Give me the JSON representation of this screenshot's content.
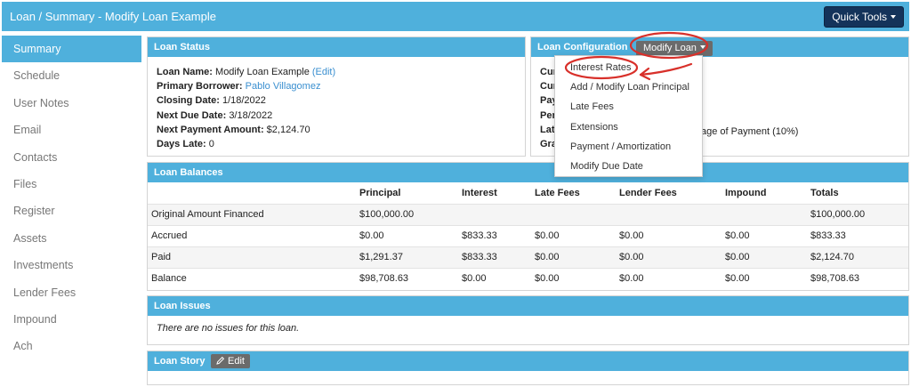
{
  "header": {
    "title": "Loan / Summary - Modify Loan Example",
    "quick_tools_label": "Quick Tools"
  },
  "sidebar": {
    "items": [
      {
        "label": "Summary",
        "active": true
      },
      {
        "label": "Schedule"
      },
      {
        "label": "User Notes"
      },
      {
        "label": "Email"
      },
      {
        "label": "Contacts"
      },
      {
        "label": "Files"
      },
      {
        "label": "Register"
      },
      {
        "label": "Assets"
      },
      {
        "label": "Investments"
      },
      {
        "label": "Lender Fees"
      },
      {
        "label": "Impound"
      },
      {
        "label": "Ach"
      }
    ]
  },
  "loan_status": {
    "title": "Loan Status",
    "loan_name_label": "Loan Name:",
    "loan_name": "Modify Loan Example",
    "edit_link": "(Edit)",
    "primary_borrower_label": "Primary Borrower:",
    "primary_borrower": "Pablo Villagomez",
    "closing_date_label": "Closing Date:",
    "closing_date": "1/18/2022",
    "next_due_label": "Next Due Date:",
    "next_due": "3/18/2022",
    "next_payment_label": "Next Payment Amount:",
    "next_payment": "$2,124.70",
    "days_late_label": "Days Late:",
    "days_late": "0"
  },
  "loan_config": {
    "title": "Loan Configuration",
    "modify_label": "Modify Loan",
    "line_fragments": [
      "Cur",
      "Cur",
      "Pay",
      "Per",
      "Lat",
      "Gra"
    ],
    "late_fee_fragment": "age of Payment (10%)",
    "menu": [
      "Interest Rates",
      "Add / Modify Loan Principal",
      "Late Fees",
      "Extensions",
      "Payment / Amortization",
      "Modify Due Date"
    ]
  },
  "balances": {
    "title": "Loan Balances",
    "columns": [
      "",
      "Principal",
      "Interest",
      "Late Fees",
      "Lender Fees",
      "Impound",
      "Totals"
    ],
    "rows": [
      [
        "Original Amount Financed",
        "$100,000.00",
        "",
        "",
        "",
        "",
        "$100,000.00"
      ],
      [
        "Accrued",
        "$0.00",
        "$833.33",
        "$0.00",
        "$0.00",
        "$0.00",
        "$833.33"
      ],
      [
        "Paid",
        "$1,291.37",
        "$833.33",
        "$0.00",
        "$0.00",
        "$0.00",
        "$2,124.70"
      ],
      [
        "Balance",
        "$98,708.63",
        "$0.00",
        "$0.00",
        "$0.00",
        "$0.00",
        "$98,708.63"
      ]
    ]
  },
  "issues": {
    "title": "Loan Issues",
    "text": "There are no issues for this loan."
  },
  "story": {
    "title": "Loan Story",
    "edit_label": "Edit"
  },
  "colors": {
    "header_blue": "#4fb0dc",
    "dark_navy": "#14335a",
    "link_blue": "#3a8fd0",
    "annotation_red": "#d8302a"
  }
}
